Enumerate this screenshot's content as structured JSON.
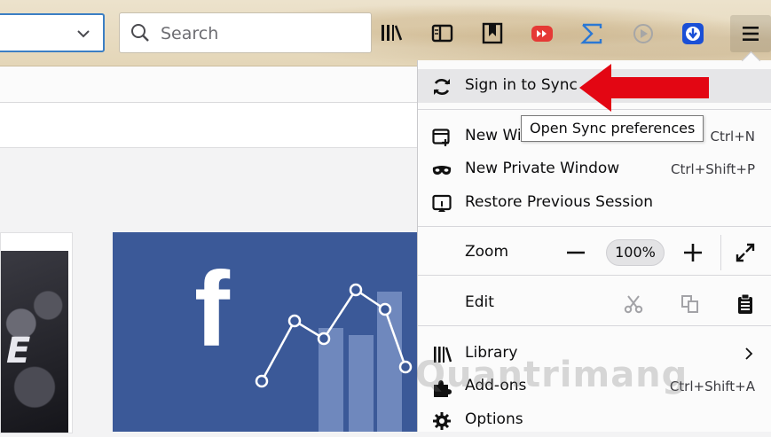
{
  "toolbar": {
    "search_placeholder": "Search",
    "icons": [
      "chevron-down-icon",
      "search-icon",
      "library-icon",
      "sidebar-icon",
      "reader-view-icon",
      "youtube-download-icon",
      "sigma-icon",
      "media-play-icon",
      "download-manager-icon",
      "hamburger-menu-icon"
    ]
  },
  "menu": {
    "sign_in": "Sign in to Sync",
    "new_window": "New Wi",
    "new_window_shortcut": "Ctrl+N",
    "new_private": "New Private Window",
    "new_private_shortcut": "Ctrl+Shift+P",
    "restore": "Restore Previous Session",
    "zoom_label": "Zoom",
    "zoom_value": "100%",
    "edit_label": "Edit",
    "library": "Library",
    "addons": "Add-ons",
    "addons_shortcut": "Ctrl+Shift+A",
    "options": "Options"
  },
  "tooltip": {
    "text": "Open Sync preferences"
  },
  "tiles": {
    "left_brand": "E",
    "facebook_letter": "f"
  },
  "watermark": "Quantrimang",
  "colors": {
    "accent_blue": "#3c7fc4",
    "facebook_blue": "#3b5998",
    "red_arrow": "#e30613"
  }
}
